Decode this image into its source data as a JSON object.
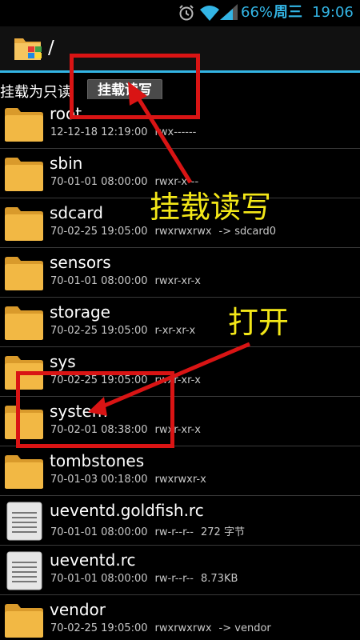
{
  "status_bar": {
    "alarm_icon": "alarm-icon",
    "wifi_icon": "wifi-icon",
    "signal_icon": "signal-icon",
    "battery": "66%",
    "day": "周三",
    "time": "19:06",
    "color": "#33b5e5"
  },
  "action_bar": {
    "icon": "file-manager-app-icon",
    "path": "/",
    "accent": "#33b5e5"
  },
  "mount": {
    "status": "挂载为只读",
    "button": "挂载读写"
  },
  "files": [
    {
      "name": "root",
      "date": "12-12-18 12:19:00",
      "perm": "rwx------",
      "extra": "",
      "type": "folder"
    },
    {
      "name": "sbin",
      "date": "70-01-01 08:00:00",
      "perm": "rwxr-x---",
      "extra": "",
      "type": "folder"
    },
    {
      "name": "sdcard",
      "date": "70-02-25 19:05:00",
      "perm": "rwxrwxrwx",
      "extra": "-> sdcard0",
      "type": "folder"
    },
    {
      "name": "sensors",
      "date": "70-01-01 08:00:00",
      "perm": "rwxr-xr-x",
      "extra": "",
      "type": "folder"
    },
    {
      "name": "storage",
      "date": "70-02-25 19:05:00",
      "perm": "r-xr-xr-x",
      "extra": "",
      "type": "folder"
    },
    {
      "name": "sys",
      "date": "70-02-25 19:05:00",
      "perm": "rwxr-xr-x",
      "extra": "",
      "type": "folder"
    },
    {
      "name": "system",
      "date": "70-02-01 08:38:00",
      "perm": "rwxr-xr-x",
      "extra": "",
      "type": "folder"
    },
    {
      "name": "tombstones",
      "date": "70-01-03 00:18:00",
      "perm": "rwxrwxr-x",
      "extra": "",
      "type": "folder"
    },
    {
      "name": "ueventd.goldfish.rc",
      "date": "70-01-01 08:00:00",
      "perm": "rw-r--r--",
      "extra": "272 字节",
      "type": "file"
    },
    {
      "name": "ueventd.rc",
      "date": "70-01-01 08:00:00",
      "perm": "rw-r--r--",
      "extra": "8.73KB",
      "type": "file"
    },
    {
      "name": "vendor",
      "date": "70-02-25 19:05:00",
      "perm": "rwxrwxrwx",
      "extra": "-> vendor",
      "type": "folder"
    }
  ],
  "annotations": {
    "mount_label": "挂载读写",
    "open_label": "打开",
    "box_color": "#d91414",
    "text_color": "#f3e718"
  }
}
